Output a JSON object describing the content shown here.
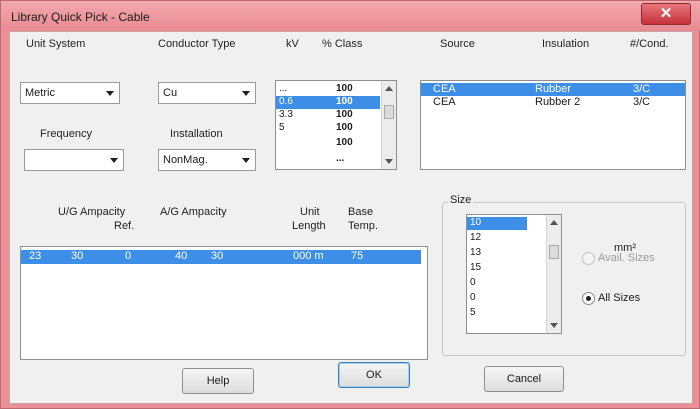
{
  "window": {
    "title": "Library Quick Pick - Cable",
    "close_glyph": "✕"
  },
  "filters": {
    "unit_system": {
      "label": "Unit System",
      "value": "Metric"
    },
    "conductor_type": {
      "label": "Conductor Type",
      "value": "Cu"
    },
    "frequency": {
      "label": "Frequency",
      "value": ""
    },
    "installation": {
      "label": "Installation",
      "value": "NonMag."
    }
  },
  "pf_list": {
    "headers": [
      "kV",
      "% Class"
    ],
    "rows": [
      {
        "kv": "...",
        "pct": "100"
      },
      {
        "kv": "0.6",
        "pct": "100"
      },
      {
        "kv": "3.3",
        "pct": "100"
      },
      {
        "kv": "5",
        "pct": "100"
      },
      {
        "kv": "",
        "pct": "100"
      },
      {
        "kv": "",
        "pct": "..."
      }
    ],
    "selected_index": 1
  },
  "source_list": {
    "headers": [
      "Source",
      "Insulation",
      "#/Cond."
    ],
    "rows": [
      {
        "source": "CEA",
        "insulation": "Rubber",
        "cond": "3/C"
      },
      {
        "source": "CEA",
        "insulation": "Rubber 2",
        "cond": "3/C"
      }
    ],
    "selected_index": 0
  },
  "ampacity_table": {
    "headers_line1": [
      "U/G Ampacity",
      "A/G Ampacity",
      "Unit",
      "Base"
    ],
    "headers_line2": [
      "",
      "",
      "Ref.",
      "",
      "",
      "Length",
      "Temp."
    ],
    "rows": [
      {
        "ug1": "23",
        "ug2": "30",
        "ref": "0",
        "ag1": "40",
        "ag2": "30",
        "unit": "000 m",
        "temp": "75"
      }
    ],
    "selected_index": 0
  },
  "size_group": {
    "title": "Size",
    "unit": "mm²",
    "items": [
      "10",
      "12",
      "13",
      "15",
      "0",
      "0",
      "5"
    ],
    "selected_index": 0,
    "radios": [
      {
        "label": "Avail. Sizes",
        "checked": false,
        "disabled": true
      },
      {
        "label": "All Sizes",
        "checked": true,
        "disabled": false
      }
    ]
  },
  "buttons": {
    "help": "Help",
    "ok": "OK",
    "cancel": "Cancel"
  },
  "colors": {
    "titlebar": "#ea8f96",
    "selection": "#3d8ee6",
    "close": "#c6323a"
  }
}
